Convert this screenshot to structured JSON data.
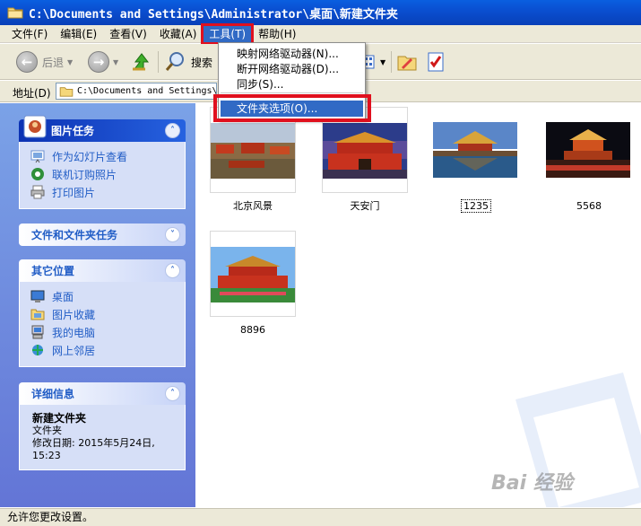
{
  "window": {
    "title": "C:\\Documents and Settings\\Administrator\\桌面\\新建文件夹"
  },
  "menubar": {
    "items": [
      {
        "label": "文件(F)"
      },
      {
        "label": "编辑(E)"
      },
      {
        "label": "查看(V)"
      },
      {
        "label": "收藏(A)"
      },
      {
        "label": "工具(T)",
        "active": true
      },
      {
        "label": "帮助(H)"
      }
    ]
  },
  "toolbar": {
    "back_label": "后退",
    "search_label": "搜索"
  },
  "address": {
    "label": "地址(D)",
    "value": "C:\\Documents and Settings\\"
  },
  "tools_menu": {
    "items": [
      {
        "label": "映射网络驱动器(N)..."
      },
      {
        "label": "断开网络驱动器(D)..."
      },
      {
        "label": "同步(S)..."
      },
      {
        "label": "文件夹选项(O)...",
        "highlighted": true
      }
    ]
  },
  "left_pane": {
    "picture_tasks": {
      "title": "图片任务",
      "items": [
        {
          "label": "作为幻灯片查看",
          "icon": "slideshow-icon"
        },
        {
          "label": "联机订购照片",
          "icon": "order-prints-icon"
        },
        {
          "label": "打印图片",
          "icon": "print-icon"
        }
      ]
    },
    "file_tasks": {
      "title": "文件和文件夹任务"
    },
    "other_places": {
      "title": "其它位置",
      "items": [
        {
          "label": "桌面",
          "icon": "desktop-icon"
        },
        {
          "label": "图片收藏",
          "icon": "my-pictures-icon"
        },
        {
          "label": "我的电脑",
          "icon": "my-computer-icon"
        },
        {
          "label": "网上邻居",
          "icon": "network-places-icon"
        }
      ]
    },
    "details": {
      "title": "详细信息",
      "name": "新建文件夹",
      "type": "文件夹",
      "modified_label": "修改日期: 2015年5月24日,",
      "modified_time": "15:23"
    }
  },
  "files": [
    {
      "name": "北京风景",
      "scene": "palace-aerial"
    },
    {
      "name": "天安门",
      "scene": "tiananmen-dusk"
    },
    {
      "name": "1235",
      "scene": "corner-tower",
      "focused": true
    },
    {
      "name": "5568",
      "scene": "night-gate"
    },
    {
      "name": "8896",
      "scene": "tiananmen-day"
    }
  ],
  "statusbar": {
    "text": "允许您更改设置。"
  },
  "watermark": {
    "text": "Bai 经验"
  },
  "colors": {
    "title_blue": "#0a4fd1",
    "highlight_red": "#e0101e",
    "selection_blue": "#316ac5",
    "link_blue": "#215dc6"
  }
}
